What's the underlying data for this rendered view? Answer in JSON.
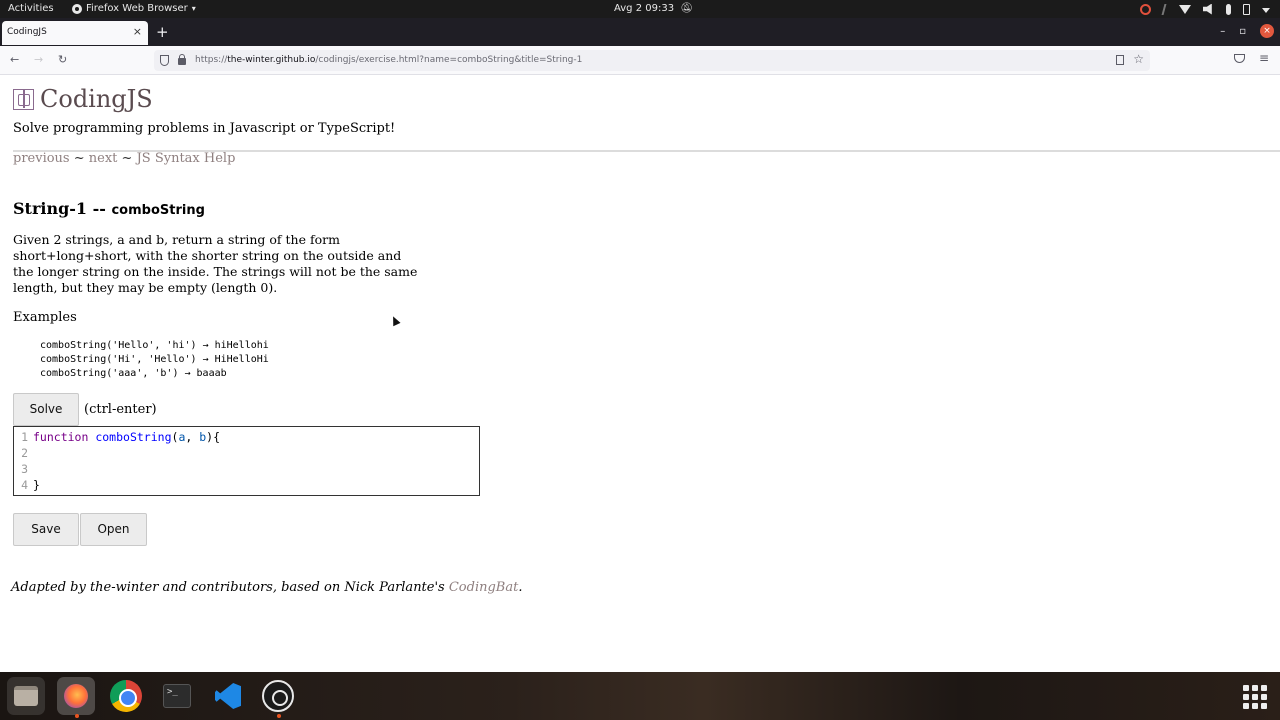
{
  "system_bar": {
    "activities": "Activities",
    "app_name": "Firefox Web Browser",
    "clock": "Avg 2  09:33"
  },
  "browser": {
    "tab_title": "CodingJS",
    "new_tab": "+",
    "url_prefix": "https://",
    "url_host": "the-winter.github.io",
    "url_path": "/codingjs/exercise.html?name=comboString&title=String-1"
  },
  "page": {
    "site_title": "CodingJS",
    "tagline": "Solve programming problems in Javascript or TypeScript!",
    "nav": {
      "previous": "previous",
      "sep1": " ~ ",
      "next": "next",
      "sep2": " ~ ",
      "help": "JS Syntax Help"
    },
    "exercise": {
      "category": "String-1 -- ",
      "name": "comboString"
    },
    "description": "Given 2 strings, a and b, return a string of the form short+long+short, with the shorter string on the outside and the longer string on the inside. The strings will not be the same length, but they may be empty (length 0).",
    "examples_label": "Examples",
    "examples": [
      "comboString('Hello', 'hi') → hiHellohi",
      "comboString('Hi', 'Hello') → HiHelloHi",
      "comboString('aaa', 'b') → baaab"
    ],
    "solve_button": "Solve",
    "solve_hint": "(ctrl-enter)",
    "editor": {
      "line_numbers": [
        "1",
        "2",
        "3",
        "4"
      ],
      "line1": {
        "kw": "function",
        "fn": "comboString",
        "open": "(",
        "a": "a",
        "comma": ", ",
        "b": "b",
        "close": "){"
      },
      "line4": "}"
    },
    "save_button": "Save",
    "open_button": "Open",
    "footer": {
      "text": "Adapted by the-winter and contributors, based on Nick Parlante's ",
      "link": "CodingBat",
      "end": "."
    }
  },
  "dock": {
    "apps": [
      "files-icon",
      "firefox-icon",
      "chrome-icon",
      "terminal-icon",
      "vscode-icon",
      "obs-icon"
    ],
    "terminal_glyph": ">_"
  },
  "colors": {
    "link": "#8f8080",
    "accent": "#e95420",
    "title": "#5a4b4f"
  }
}
